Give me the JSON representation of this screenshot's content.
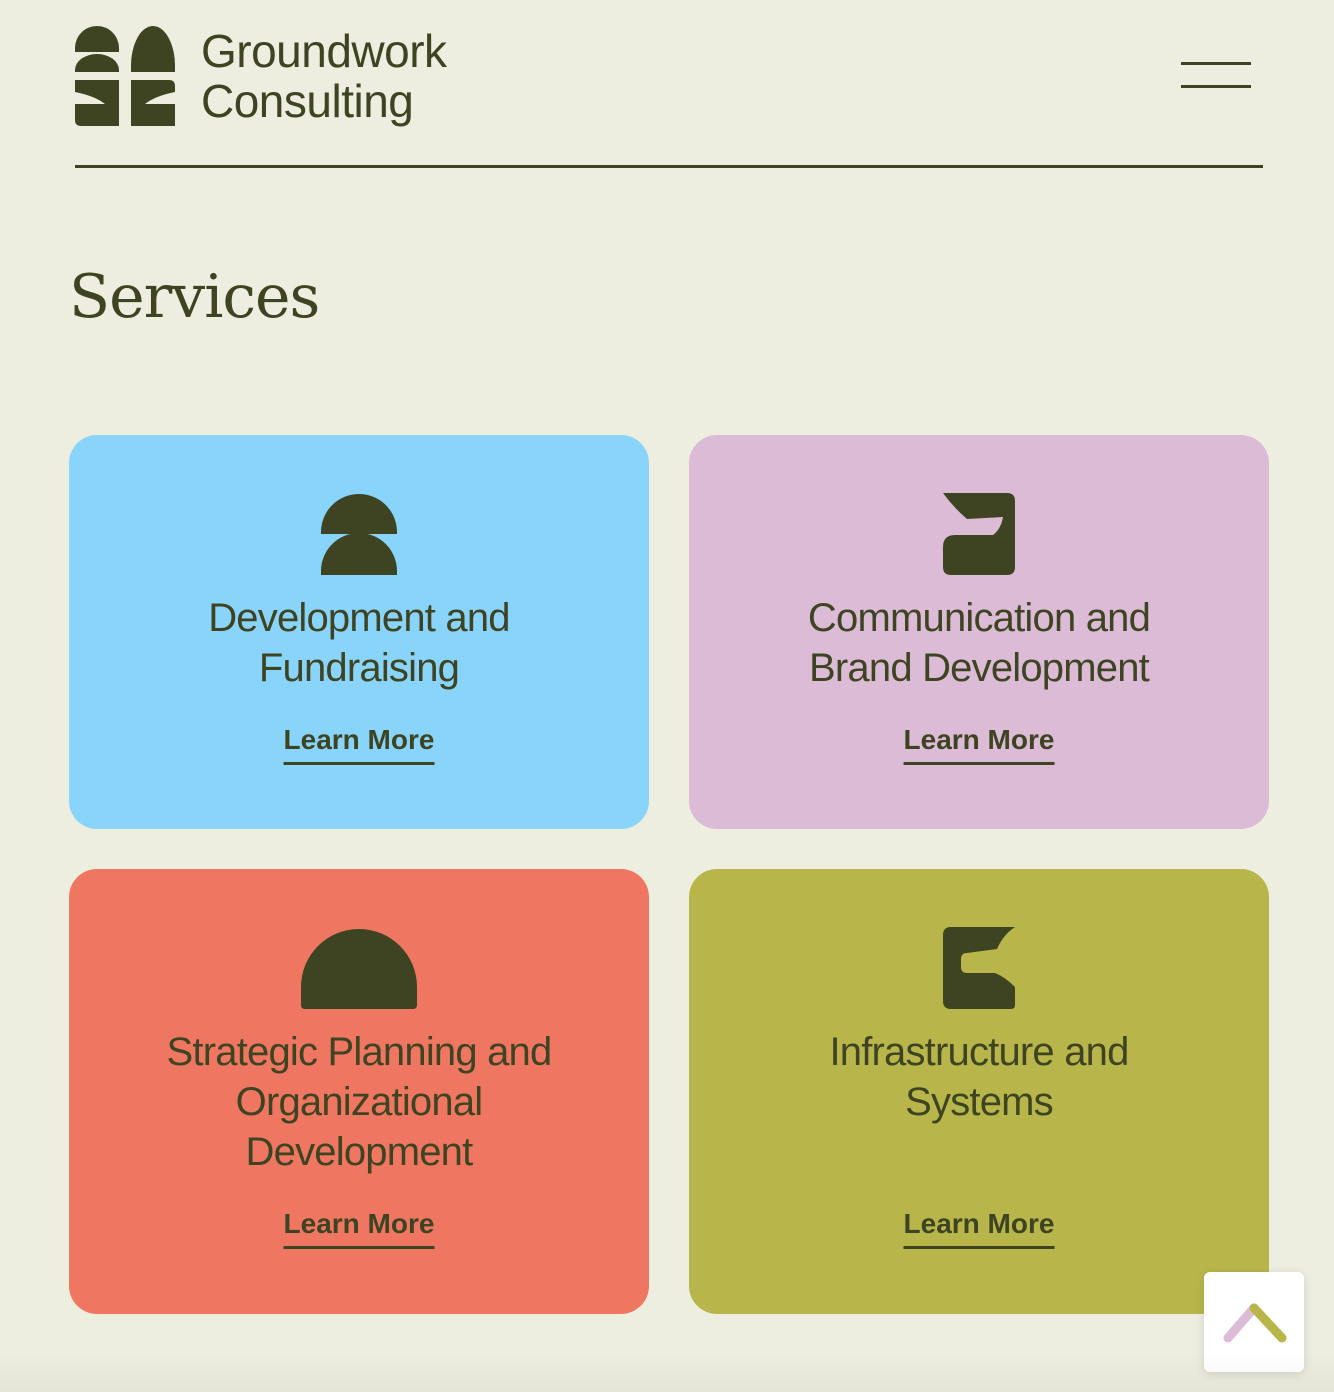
{
  "header": {
    "logo_line1": "Groundwork",
    "logo_line2": "Consulting",
    "menu_icon": "hamburger-menu-icon"
  },
  "colors": {
    "background": "#edeee0",
    "ink": "#3e4422",
    "card_blue": "#89d4fb",
    "card_pink": "#dcbbd6",
    "card_coral": "#ef7762",
    "card_olive": "#b8b64b"
  },
  "services": {
    "heading": "Services",
    "cards": [
      {
        "title_line1": "Development and",
        "title_line2": "Fundraising",
        "link": "Learn More",
        "icon": "stacked-half-circles-icon"
      },
      {
        "title_line1": "Communication and",
        "title_line2": "Brand Development",
        "link": "Learn More",
        "icon": "leaf-shape-icon"
      },
      {
        "title_line1": "Strategic Planning and",
        "title_line2": "Organizational",
        "title_line3": "Development",
        "link": "Learn More",
        "icon": "dome-icon"
      },
      {
        "title_line1": "Infrastructure and",
        "title_line2": "Systems",
        "link": "Learn More",
        "icon": "notched-block-icon"
      }
    ]
  },
  "back_to_top": {
    "icon": "chevron-up-icon"
  }
}
